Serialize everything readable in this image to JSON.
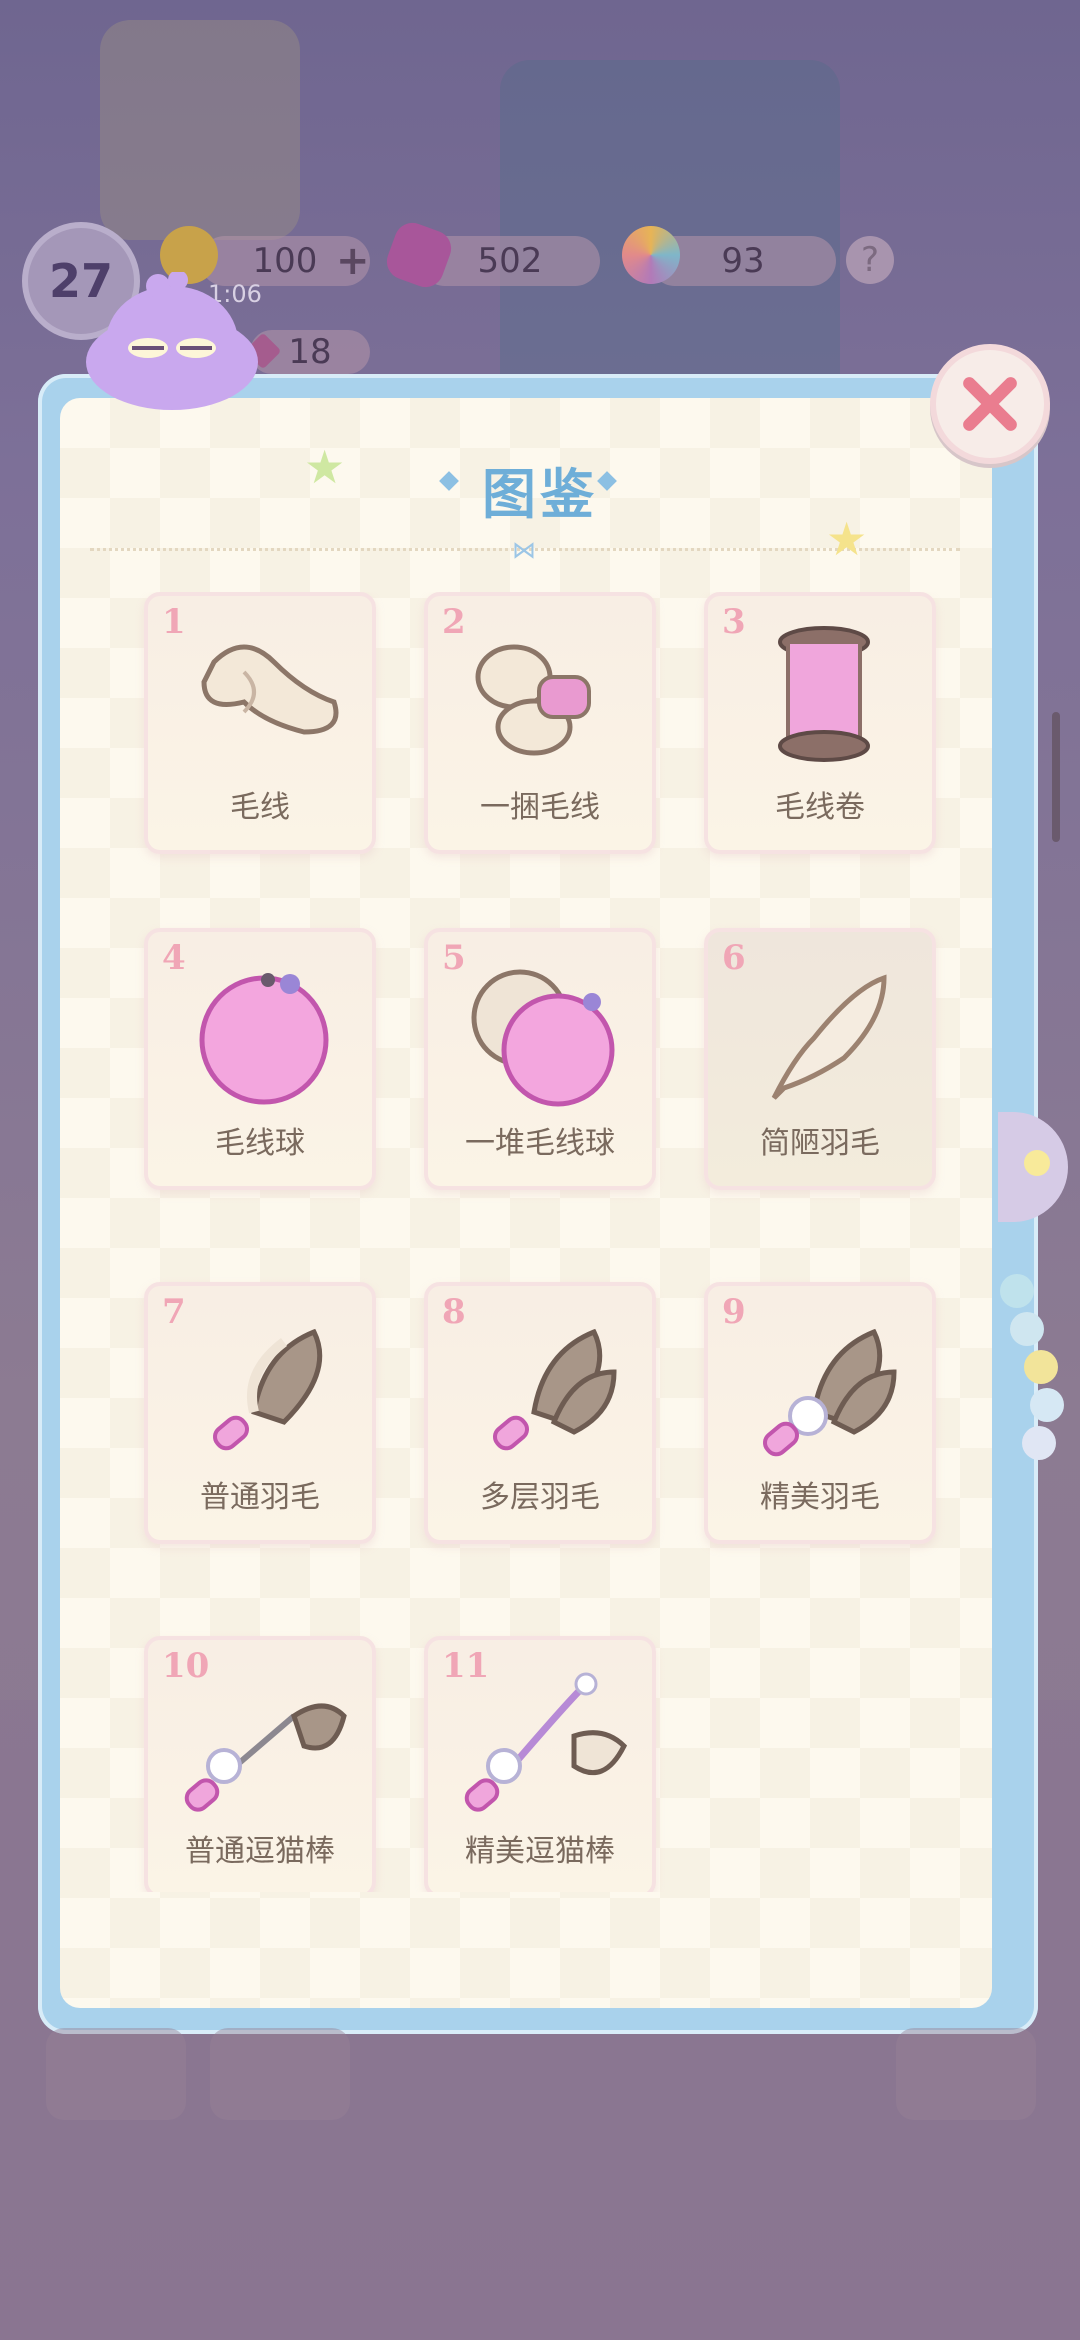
{
  "hud": {
    "level": "27",
    "energy": "100",
    "energy_plus": "+",
    "timer": "1:06",
    "gems": "502",
    "stars": "93",
    "help": "?",
    "tickets": "18"
  },
  "panel": {
    "title": "图鉴",
    "close_label": "×"
  },
  "items": [
    {
      "num": "1",
      "name": "毛线",
      "icon": "yarn-skein-icon"
    },
    {
      "num": "2",
      "name": "一捆毛线",
      "icon": "yarn-bundle-icon"
    },
    {
      "num": "3",
      "name": "毛线卷",
      "icon": "yarn-spool-icon"
    },
    {
      "num": "4",
      "name": "毛线球",
      "icon": "yarn-ball-icon"
    },
    {
      "num": "5",
      "name": "一堆毛线球",
      "icon": "yarn-balls-pile-icon"
    },
    {
      "num": "6",
      "name": "简陋羽毛",
      "icon": "simple-feather-icon"
    },
    {
      "num": "7",
      "name": "普通羽毛",
      "icon": "feather-duster-icon"
    },
    {
      "num": "8",
      "name": "多层羽毛",
      "icon": "layered-feather-icon"
    },
    {
      "num": "9",
      "name": "精美羽毛",
      "icon": "fancy-feather-icon"
    },
    {
      "num": "10",
      "name": "普通逗猫棒",
      "icon": "cat-teaser-icon"
    },
    {
      "num": "11",
      "name": "精美逗猫棒",
      "icon": "fancy-cat-teaser-icon"
    }
  ],
  "colors": {
    "panel_border": "#a9d2ec",
    "panel_bg": "#fdf9ee",
    "title": "#6eaed8",
    "number": "#f0a6b6",
    "close_x": "#ea7d8f"
  }
}
